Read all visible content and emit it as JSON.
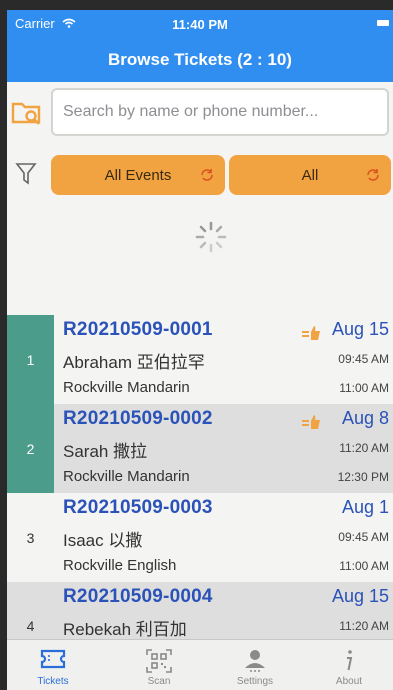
{
  "status": {
    "carrier": "Carrier",
    "time": "11:40 PM"
  },
  "header": {
    "title": "Browse Tickets (2 : 10)"
  },
  "search": {
    "placeholder": "Search by name or phone number..."
  },
  "filters": {
    "events_label": "All Events",
    "status_label": "All"
  },
  "tickets": [
    {
      "number": "1",
      "ticket_no": "R20210509-0001",
      "person": "Abraham 亞伯拉罕",
      "event": "Rockville Mandarin",
      "date": "Aug 15",
      "time_start": "09:45 AM",
      "time_end": "11:00 AM",
      "selected": true,
      "flagged": true
    },
    {
      "number": "2",
      "ticket_no": "R20210509-0002",
      "person": "Sarah 撒拉",
      "event": "Rockville Mandarin",
      "date": "Aug 8",
      "time_start": "11:20 AM",
      "time_end": "12:30 PM",
      "selected": true,
      "flagged": true
    },
    {
      "number": "3",
      "ticket_no": "R20210509-0003",
      "person": "Isaac 以撒",
      "event": "Rockville English",
      "date": "Aug 1",
      "time_start": "09:45 AM",
      "time_end": "11:00 AM",
      "selected": false,
      "flagged": false
    },
    {
      "number": "4",
      "ticket_no": "R20210509-0004",
      "person": "Rebekah 利百加",
      "event": "",
      "date": "Aug 15",
      "time_start": "11:20 AM",
      "time_end": "",
      "selected": false,
      "flagged": false
    }
  ],
  "tabs": [
    {
      "label": "Tickets",
      "icon": "ticket-icon",
      "active": true
    },
    {
      "label": "Scan",
      "icon": "qr-code-icon",
      "active": false
    },
    {
      "label": "Settings",
      "icon": "person-icon",
      "active": false
    },
    {
      "label": "About",
      "icon": "info-icon",
      "active": false
    }
  ],
  "colors": {
    "header": "#2f8ef0",
    "pill": "#f2a341",
    "selected": "#4c9c8c",
    "ticket_text": "#2a52b8"
  }
}
